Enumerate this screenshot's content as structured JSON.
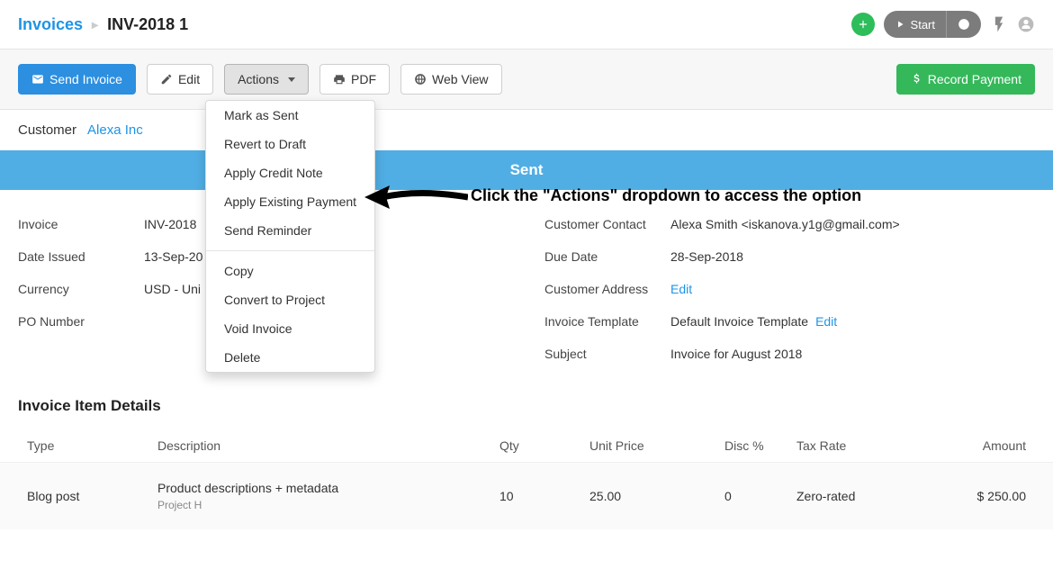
{
  "breadcrumb": {
    "root": "Invoices",
    "current": "INV-2018 1"
  },
  "topright": {
    "start": "Start"
  },
  "toolbar": {
    "send": "Send Invoice",
    "edit": "Edit",
    "actions": "Actions",
    "pdf": "PDF",
    "webview": "Web View",
    "record_payment": "Record Payment"
  },
  "actions_menu": {
    "mark_as_sent": "Mark as Sent",
    "revert_to_draft": "Revert to Draft",
    "apply_credit_note": "Apply Credit Note",
    "apply_existing_payment": "Apply Existing Payment",
    "send_reminder": "Send Reminder",
    "copy": "Copy",
    "convert_to_project": "Convert to Project",
    "void_invoice": "Void Invoice",
    "delete": "Delete"
  },
  "annotation": "Click the \"Actions\" dropdown to access the option",
  "customer": {
    "label": "Customer",
    "name": "Alexa Inc"
  },
  "status": "Sent",
  "details": {
    "left": {
      "invoice_label": "Invoice",
      "invoice_value": "INV-2018",
      "date_issued_label": "Date Issued",
      "date_issued_value": "13-Sep-20",
      "currency_label": "Currency",
      "currency_value": "USD - Uni",
      "po_label": "PO Number",
      "po_value": ""
    },
    "right": {
      "contact_label": "Customer Contact",
      "contact_value": "Alexa Smith <iskanova.y1g@gmail.com>",
      "due_label": "Due Date",
      "due_value": "28-Sep-2018",
      "address_label": "Customer Address",
      "address_edit": "Edit",
      "template_label": "Invoice Template",
      "template_value": "Default Invoice Template",
      "template_edit": "Edit",
      "subject_label": "Subject",
      "subject_value": "Invoice for August 2018"
    }
  },
  "items": {
    "title": "Invoice Item Details",
    "headers": {
      "type": "Type",
      "desc": "Description",
      "qty": "Qty",
      "price": "Unit Price",
      "disc": "Disc %",
      "tax": "Tax Rate",
      "amount": "Amount"
    },
    "rows": [
      {
        "type": "Blog post",
        "desc": "Product descriptions + metadata",
        "sub": "Project H",
        "qty": "10",
        "price": "25.00",
        "disc": "0",
        "tax": "Zero-rated",
        "amount": "$ 250.00"
      }
    ]
  }
}
